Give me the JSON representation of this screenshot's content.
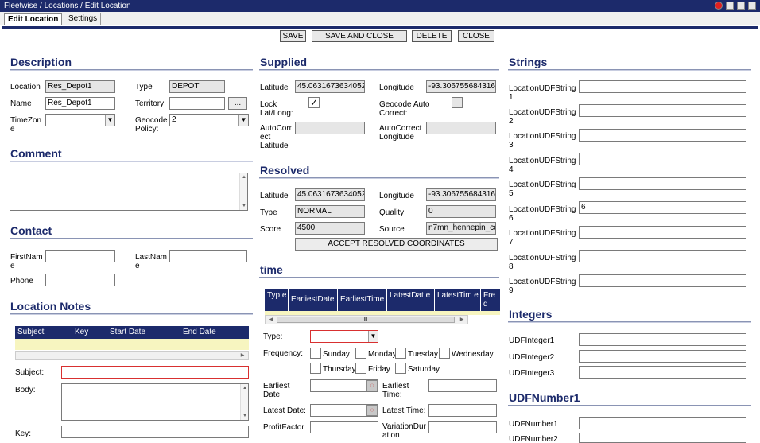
{
  "titlebar": {
    "title": "Fleetwise / Locations / Edit Location"
  },
  "tabs": [
    "Edit Location",
    "Settings"
  ],
  "toolbar": {
    "save": "SAVE",
    "save_close": "SAVE AND CLOSE",
    "delete": "DELETE",
    "close": "CLOSE"
  },
  "description": {
    "heading": "Description",
    "location_label": "Location",
    "location_value": "Res_Depot1",
    "type_label": "Type",
    "type_value": "DEPOT",
    "name_label": "Name",
    "name_value": "Res_Depot1",
    "territory_label": "Territory",
    "territory_value": "",
    "territory_btn": "...",
    "timezone_label": "TimeZon e",
    "timezone_value": "",
    "geocode_policy_label": "Geocode Policy:",
    "geocode_policy_value": "2"
  },
  "comment": {
    "heading": "Comment",
    "value": ""
  },
  "contact": {
    "heading": "Contact",
    "firstname_label": "FirstNam e",
    "lastname_label": "LastNam e",
    "phone_label": "Phone"
  },
  "location_notes": {
    "heading": "Location Notes",
    "columns": [
      "Subject",
      "Key",
      "Start Date",
      "End Date"
    ],
    "subject_label": "Subject:",
    "body_label": "Body:",
    "key_label": "Key:"
  },
  "supplied": {
    "heading": "Supplied",
    "latitude_label": "Latitude",
    "latitude_value": "45.0631673634052",
    "longitude_label": "Longitude",
    "longitude_value": "-93.306755684316",
    "lock_label": "Lock Lat/Long:",
    "lock_checked": "✓",
    "geocode_auto_label": "Geocode Auto Correct:",
    "autocorrect_lat_label": "AutoCorr ect Latitude",
    "autocorrect_lon_label": "AutoCorrect Longitude"
  },
  "resolved": {
    "heading": "Resolved",
    "latitude_label": "Latitude",
    "latitude_value": "45.0631673634052",
    "longitude_label": "Longitude",
    "longitude_value": "-93.306755684316",
    "type_label": "Type",
    "type_value": "NORMAL",
    "quality_label": "Quality",
    "quality_value": "0",
    "score_label": "Score",
    "score_value": "4500",
    "source_label": "Source",
    "source_value": "n7mn_hennepin_co",
    "accept_btn": "ACCEPT RESOLVED COORDINATES"
  },
  "time": {
    "heading": "time",
    "columns": [
      "Typ e",
      "EarliestDate",
      "EarliestTime",
      "LatestDat e",
      "LatestTim e",
      "Fre q"
    ],
    "scroll_grip": "III",
    "type_label": "Type:",
    "frequency_label": "Frequency:",
    "days": [
      "Sunday",
      "Monday",
      "Tuesday",
      "Wednesday",
      "Thursday",
      "Friday",
      "Saturday"
    ],
    "earliest_date_label": "Earliest Date:",
    "earliest_time_label": "Earliest Time:",
    "latest_date_label": "Latest Date:",
    "latest_time_label": "Latest Time:",
    "profit_label": "ProfitFactor",
    "variation_label": "VariationDur ation"
  },
  "strings": {
    "heading": "Strings",
    "items": [
      {
        "label": "LocationUDFString 1",
        "value": ""
      },
      {
        "label": "LocationUDFString 2",
        "value": ""
      },
      {
        "label": "LocationUDFString 3",
        "value": ""
      },
      {
        "label": "LocationUDFString 4",
        "value": ""
      },
      {
        "label": "LocationUDFString 5",
        "value": ""
      },
      {
        "label": "LocationUDFString 6",
        "value": "6"
      },
      {
        "label": "LocationUDFString 7",
        "value": ""
      },
      {
        "label": "LocationUDFString 8",
        "value": ""
      },
      {
        "label": "LocationUDFString 9",
        "value": ""
      }
    ]
  },
  "integers": {
    "heading": "Integers",
    "items": [
      "UDFInteger1",
      "UDFInteger2",
      "UDFInteger3"
    ]
  },
  "numbers": {
    "heading": "UDFNumber1",
    "items": [
      "UDFNumber1",
      "UDFNumber2"
    ]
  },
  "icons": {
    "dropdown": "dropdown-arrow-icon",
    "calendar": "calendar-icon",
    "scroll": "scroll-arrow-icon"
  }
}
